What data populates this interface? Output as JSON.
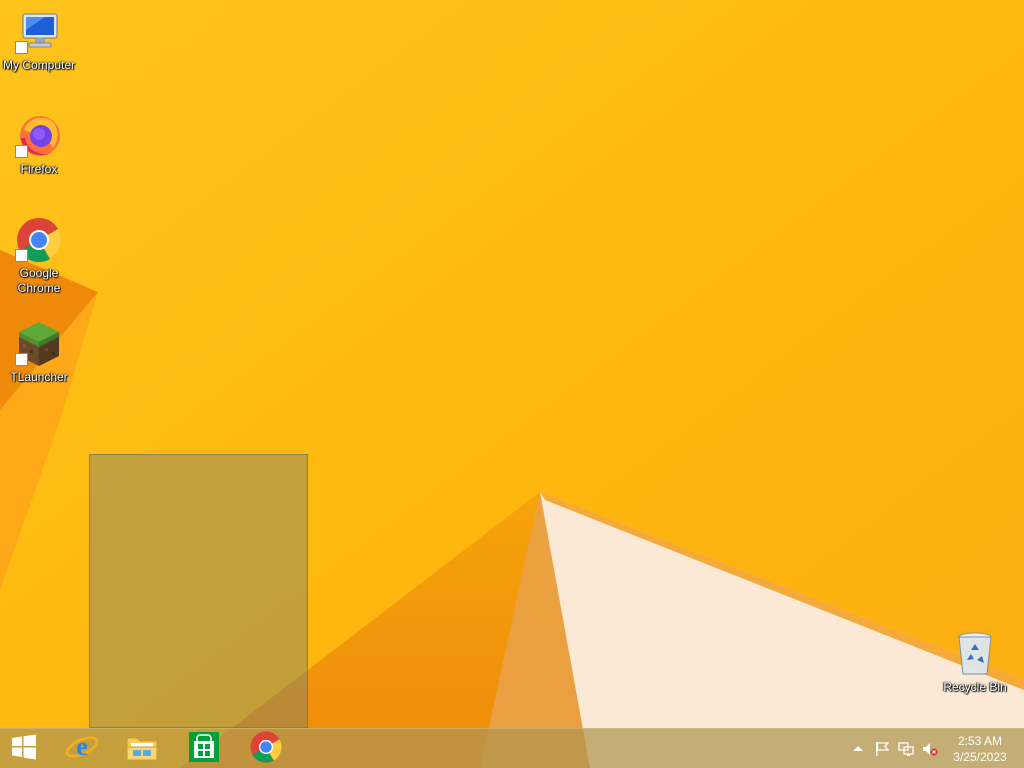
{
  "desktop": {
    "icons": [
      {
        "label": "My Computer",
        "icon": "computer-icon"
      },
      {
        "label": "Firefox",
        "icon": "firefox-icon"
      },
      {
        "label": "Google Chrome",
        "icon": "chrome-icon"
      },
      {
        "label": "TLauncher",
        "icon": "minecraft-grass-block-icon"
      },
      {
        "label": "Recycle Bin",
        "icon": "recycle-bin-icon"
      }
    ]
  },
  "taskbar": {
    "buttons": [
      {
        "name": "start",
        "icon": "windows-logo-icon"
      },
      {
        "name": "internet-explorer",
        "icon": "internet-explorer-icon"
      },
      {
        "name": "file-explorer",
        "icon": "folder-icon"
      },
      {
        "name": "store",
        "icon": "store-icon"
      },
      {
        "name": "chrome",
        "icon": "chrome-icon"
      }
    ],
    "tray": {
      "icons": [
        "chevron-up-icon",
        "flag-icon",
        "network-icon",
        "speaker-muted-icon"
      ],
      "time": "2:53 AM",
      "date": "3/25/2023"
    }
  },
  "colors": {
    "wallpaper": "#ffb90f",
    "selection": "#8a9070",
    "taskbar": "#b09650"
  }
}
